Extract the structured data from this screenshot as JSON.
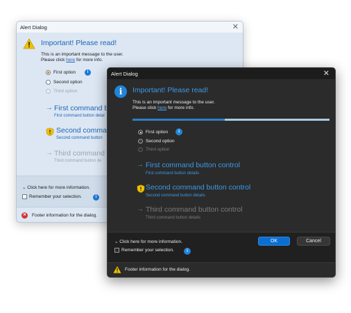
{
  "light_dialog": {
    "title": "Alert Dialog",
    "close_glyph": "✕",
    "main_icon": "warning-icon",
    "heading": "Important! Please read!",
    "message_line1": "This is an important message to the user.",
    "message_pre": "Please click ",
    "message_link": "here",
    "message_post": " for more info.",
    "radios": [
      {
        "label": "First option",
        "selected": true,
        "disabled": false
      },
      {
        "label": "Second option",
        "selected": false,
        "disabled": false
      },
      {
        "label": "Third option",
        "selected": false,
        "disabled": true
      }
    ],
    "info_glyph": "i",
    "commands": [
      {
        "title": "First command b",
        "detail": "First command button detai",
        "icon": "arrow-right-icon",
        "disabled": false
      },
      {
        "title": "Second comman",
        "detail": "Second command button",
        "icon": "shield-icon",
        "disabled": false
      },
      {
        "title": "Third command b",
        "detail": "Third command button de",
        "icon": "arrow-right-icon",
        "disabled": true
      }
    ],
    "expander": "Click here for more information.",
    "checkbox": "Remember your selection.",
    "footer": "Footer information for the dialog.",
    "footer_icon": "error-icon",
    "error_glyph": "✕"
  },
  "dark_dialog": {
    "title": "Alert Dialog",
    "close_glyph": "✕",
    "main_icon": "info-icon",
    "heading": "Important! Please read!",
    "message_line1": "This is an important message to the user.",
    "message_pre": "Please click ",
    "message_link": "here",
    "message_post": " for more info.",
    "progress_fraction": 0.47,
    "radios": [
      {
        "label": "First option",
        "selected": true,
        "disabled": false
      },
      {
        "label": "Second option",
        "selected": false,
        "disabled": false
      },
      {
        "label": "Third option",
        "selected": false,
        "disabled": true
      }
    ],
    "info_glyph": "i",
    "commands": [
      {
        "title": "First command button control",
        "detail": "First command button details",
        "icon": "arrow-right-icon",
        "disabled": false
      },
      {
        "title": "Second command button control",
        "detail": "Second command button details",
        "icon": "shield-icon",
        "disabled": false
      },
      {
        "title": "Third command button control",
        "detail": "Third command button details",
        "icon": "arrow-right-icon",
        "disabled": true
      }
    ],
    "expander": "Click here for more information.",
    "checkbox": "Remember your selection.",
    "ok_label": "OK",
    "cancel_label": "Cancel",
    "footer": "Footer information for the dialog.",
    "footer_icon": "warning-icon"
  },
  "colors": {
    "accent_light": "#1f64b5",
    "accent_dark": "#3b9ae8",
    "ok_button": "#0a6fd2",
    "warning": "#f2c200",
    "error": "#d13438"
  }
}
